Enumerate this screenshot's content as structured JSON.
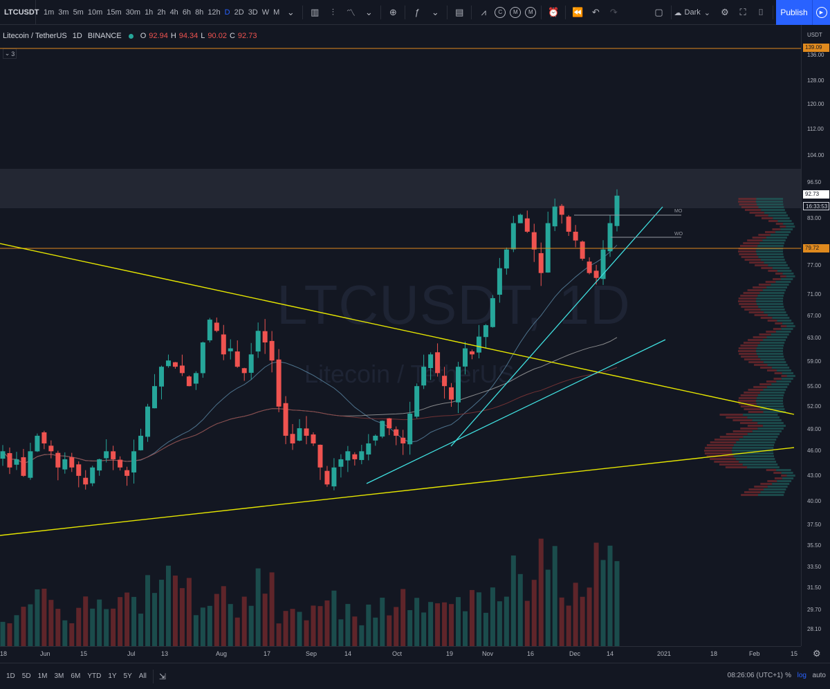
{
  "toolbar": {
    "symbol": "LTCUSDT",
    "intervals": [
      "1m",
      "3m",
      "5m",
      "10m",
      "15m",
      "30m",
      "1h",
      "2h",
      "4h",
      "6h",
      "8h",
      "12h",
      "D",
      "2D",
      "3D",
      "W",
      "M"
    ],
    "active_interval": "D",
    "theme": "Dark",
    "publish": "Publish"
  },
  "legend": {
    "title": "Litecoin / TetherUS",
    "interval": "1D",
    "exchange": "BINANCE",
    "o_label": "O",
    "o": "92.94",
    "h_label": "H",
    "h": "94.34",
    "l_label": "L",
    "l": "90.02",
    "c_label": "C",
    "c": "92.73",
    "collapse_count": "3"
  },
  "watermark": {
    "main": "LTCUSDT, 1D",
    "sub": "Litecoin / TetherUS"
  },
  "price_axis": {
    "currency": "USDT",
    "ticks": [
      "136.00",
      "128.00",
      "120.00",
      "112.00",
      "104.00",
      "96.50",
      "83.00",
      "77.00",
      "71.00",
      "67.00",
      "63.00",
      "59.00",
      "55.00",
      "52.00",
      "49.00",
      "46.00",
      "43.00",
      "40.00",
      "37.50",
      "35.50",
      "33.50",
      "31.50",
      "29.70",
      "28.10"
    ],
    "tag_high": "139.09",
    "tag_last": "92.73",
    "tag_countdown": "16:33:53",
    "tag_level": "79.72"
  },
  "time_axis": [
    "18",
    "Jun",
    "15",
    "Jul",
    "13",
    "Aug",
    "17",
    "Sep",
    "14",
    "Oct",
    "19",
    "Nov",
    "16",
    "Dec",
    "14",
    "2021",
    "18",
    "Feb",
    "15"
  ],
  "annotations": {
    "mo": "MO",
    "wo": "WO"
  },
  "bottom": {
    "ranges": [
      "1D",
      "5D",
      "1M",
      "3M",
      "6M",
      "YTD",
      "1Y",
      "5Y",
      "All"
    ],
    "clock": "08:26:06 (UTC+1)",
    "percent": "%",
    "log": "log",
    "auto": "auto"
  },
  "colors": {
    "bg": "#131722",
    "up": "#26a69a",
    "down": "#ef5350",
    "trendline_yellow": "#e6e600",
    "trendline_cyan": "#40e0e0",
    "level_orange": "#e08a1e",
    "accent": "#2962ff"
  },
  "chart_data": {
    "type": "candlestick",
    "symbol": "LTCUSDT",
    "interval": "1D",
    "last": {
      "open": 92.94,
      "high": 94.34,
      "low": 90.02,
      "close": 92.73
    },
    "approx_closes": [
      46,
      44,
      45,
      43,
      46,
      48,
      47,
      46,
      44,
      45,
      44,
      43,
      42,
      44,
      45,
      46,
      45,
      44,
      43,
      46,
      48,
      52,
      55,
      58,
      59,
      58,
      57,
      55,
      57,
      62,
      66,
      64,
      60,
      61,
      58,
      57,
      60,
      64,
      62,
      59,
      52,
      48,
      47,
      49,
      48,
      47,
      44,
      42,
      44,
      45,
      46,
      45,
      46,
      47,
      48,
      50,
      49,
      48,
      47,
      51,
      55,
      58,
      60,
      57,
      55,
      53,
      58,
      61,
      60,
      63,
      65,
      70,
      76,
      80,
      86,
      88,
      84,
      80,
      75,
      86,
      90,
      88,
      84,
      82,
      78,
      75,
      74,
      80,
      86,
      92.73
    ],
    "horizontal_levels": [
      139.09,
      79.72
    ],
    "ylim": [
      26,
      140
    ]
  }
}
